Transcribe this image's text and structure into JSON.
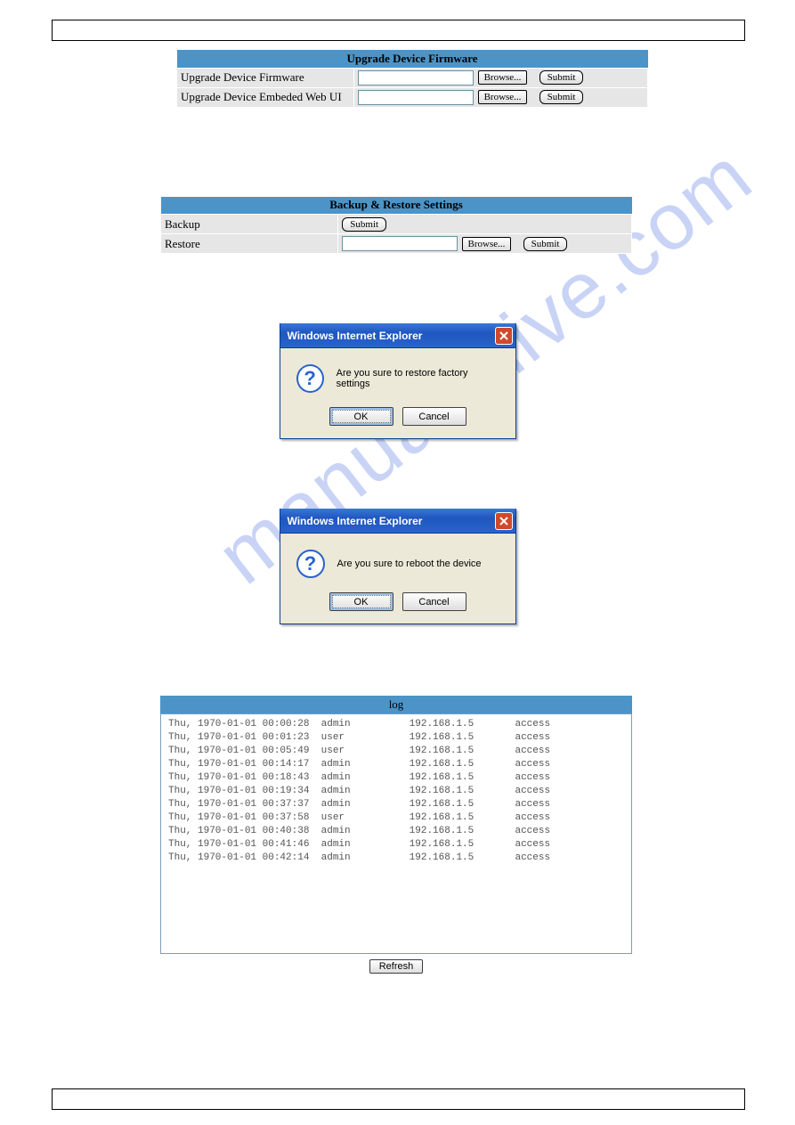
{
  "upgrade": {
    "header": "Upgrade Device Firmware",
    "rows": [
      {
        "label": "Upgrade Device Firmware",
        "browse": "Browse...",
        "submit": "Submit"
      },
      {
        "label": "Upgrade Device Embeded Web UI",
        "browse": "Browse...",
        "submit": "Submit"
      }
    ]
  },
  "backup": {
    "header": "Backup & Restore Settings",
    "row_backup": {
      "label": "Backup",
      "submit": "Submit"
    },
    "row_restore": {
      "label": "Restore",
      "browse": "Browse...",
      "submit": "Submit"
    }
  },
  "dialog1": {
    "title": "Windows Internet Explorer",
    "message": "Are you sure to restore factory settings",
    "ok": "OK",
    "cancel": "Cancel"
  },
  "dialog2": {
    "title": "Windows Internet Explorer",
    "message": "Are you sure to reboot the device",
    "ok": "OK",
    "cancel": "Cancel"
  },
  "log": {
    "header": "log",
    "refresh": "Refresh",
    "entries": [
      {
        "ts": "Thu, 1970-01-01 00:00:28",
        "user": "admin",
        "ip": "192.168.1.5",
        "action": "access"
      },
      {
        "ts": "Thu, 1970-01-01 00:01:23",
        "user": "user",
        "ip": "192.168.1.5",
        "action": "access"
      },
      {
        "ts": "Thu, 1970-01-01 00:05:49",
        "user": "user",
        "ip": "192.168.1.5",
        "action": "access"
      },
      {
        "ts": "Thu, 1970-01-01 00:14:17",
        "user": "admin",
        "ip": "192.168.1.5",
        "action": "access"
      },
      {
        "ts": "Thu, 1970-01-01 00:18:43",
        "user": "admin",
        "ip": "192.168.1.5",
        "action": "access"
      },
      {
        "ts": "Thu, 1970-01-01 00:19:34",
        "user": "admin",
        "ip": "192.168.1.5",
        "action": "access"
      },
      {
        "ts": "Thu, 1970-01-01 00:37:37",
        "user": "admin",
        "ip": "192.168.1.5",
        "action": "access"
      },
      {
        "ts": "Thu, 1970-01-01 00:37:58",
        "user": "user",
        "ip": "192.168.1.5",
        "action": "access"
      },
      {
        "ts": "Thu, 1970-01-01 00:40:38",
        "user": "admin",
        "ip": "192.168.1.5",
        "action": "access"
      },
      {
        "ts": "Thu, 1970-01-01 00:41:46",
        "user": "admin",
        "ip": "192.168.1.5",
        "action": "access"
      },
      {
        "ts": "Thu, 1970-01-01 00:42:14",
        "user": "admin",
        "ip": "192.168.1.5",
        "action": "access"
      }
    ]
  },
  "watermark": "manualshive.com"
}
